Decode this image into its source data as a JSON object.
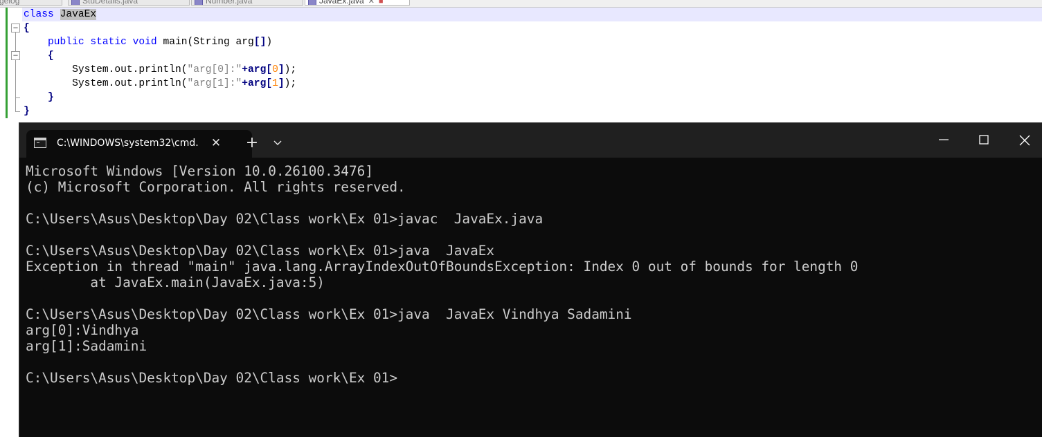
{
  "editor": {
    "tabs": [
      {
        "label": "gelog",
        "active": false
      },
      {
        "label": "StuDetails.java",
        "active": false
      },
      {
        "label": "Number.java",
        "active": false
      },
      {
        "label": "JavaEx.java",
        "active": true
      }
    ],
    "code": {
      "l1_kw": "class",
      "l1_name": "JavaEx",
      "l2": "{",
      "l3_kw1": "public",
      "l3_kw2": "static",
      "l3_kw3": "void",
      "l3_rest": " main(String arg",
      "l3_br": "[]",
      "l3_end": ")",
      "l4": "{",
      "l5_pre": "System.out.println(",
      "l5_str": "\"arg[0]:\"",
      "l5_plus": "+arg",
      "l5_idx": "0",
      "l5_end": ");",
      "l6_pre": "System.out.println(",
      "l6_str": "\"arg[1]:\"",
      "l6_plus": "+arg",
      "l6_idx": "1",
      "l6_end": ");",
      "l7": "}",
      "l8": "}"
    }
  },
  "terminal": {
    "tab_title": "C:\\WINDOWS\\system32\\cmd.",
    "icon": "cmd-icon",
    "lines": {
      "l1": "Microsoft Windows [Version 10.0.26100.3476]",
      "l2": "(c) Microsoft Corporation. All rights reserved.",
      "l3": "C:\\Users\\Asus\\Desktop\\Day 02\\Class work\\Ex 01>javac  JavaEx.java",
      "l4": "C:\\Users\\Asus\\Desktop\\Day 02\\Class work\\Ex 01>java  JavaEx",
      "l5": "Exception in thread \"main\" java.lang.ArrayIndexOutOfBoundsException: Index 0 out of bounds for length 0",
      "l6": "        at JavaEx.main(JavaEx.java:5)",
      "l7": "C:\\Users\\Asus\\Desktop\\Day 02\\Class work\\Ex 01>java  JavaEx Vindhya Sadamini",
      "l8": "arg[0]:Vindhya",
      "l9": "arg[1]:Sadamini",
      "l10": "C:\\Users\\Asus\\Desktop\\Day 02\\Class work\\Ex 01>"
    }
  },
  "colors": {
    "terminal_bg": "#0c0c0c",
    "titlebar_bg": "#202020",
    "keyword": "#0000ff",
    "string": "#808080",
    "number": "#ff8000",
    "change_marker": "#35a035"
  }
}
